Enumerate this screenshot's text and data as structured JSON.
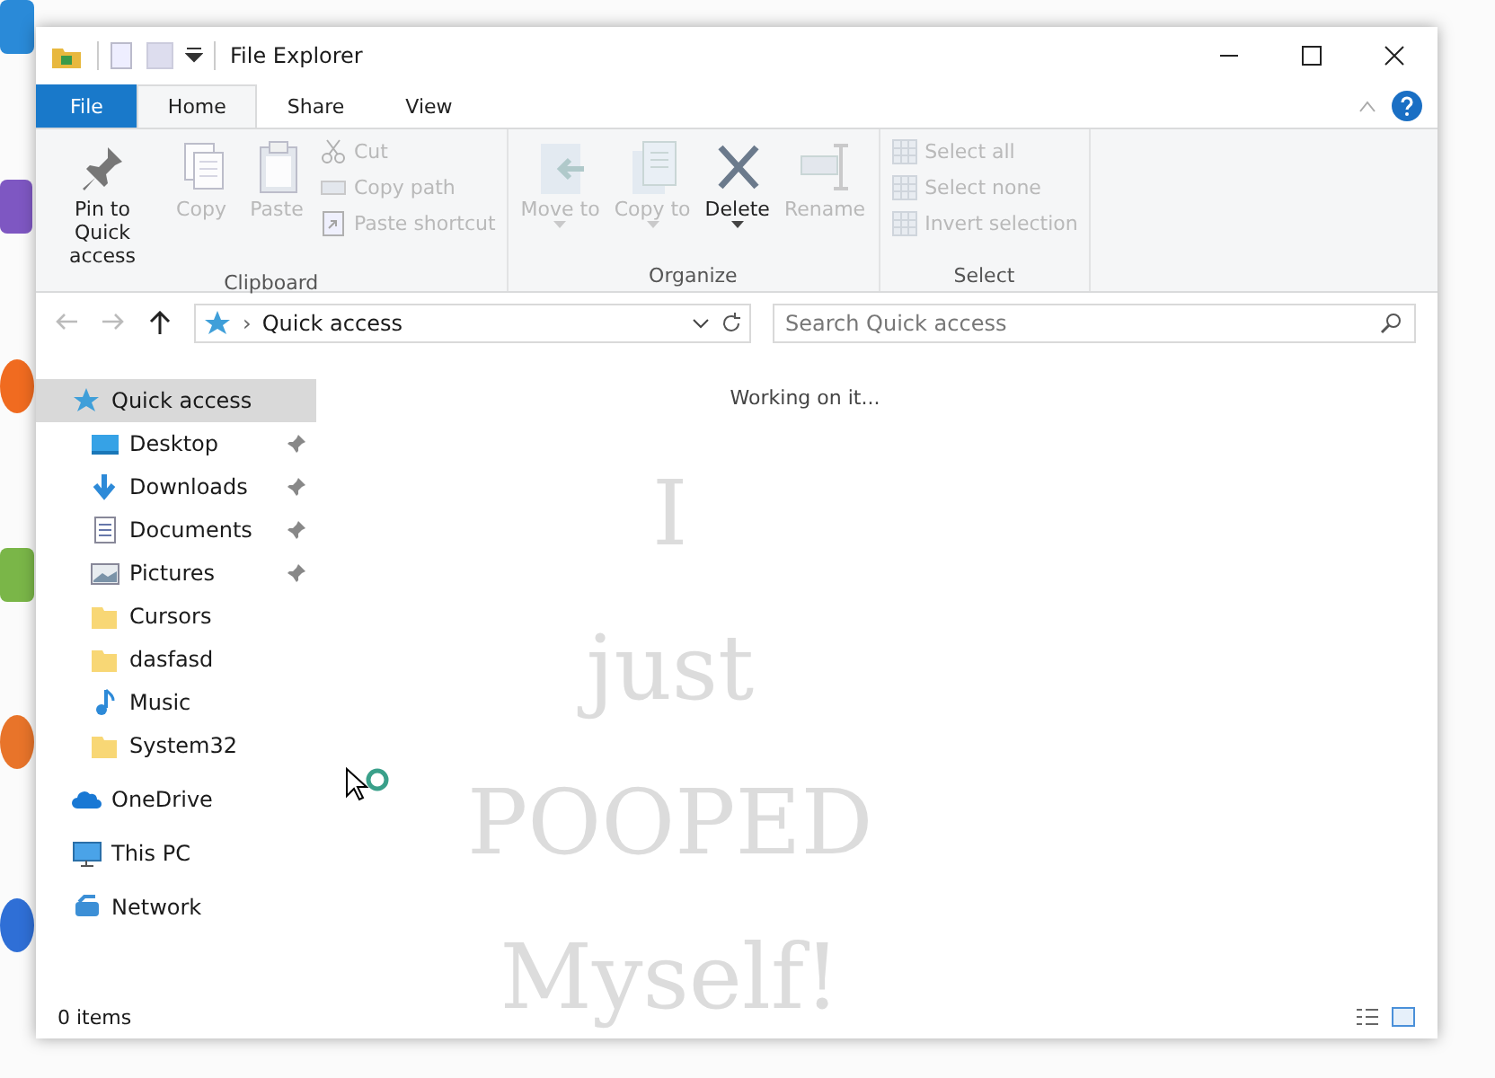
{
  "window": {
    "title": "File Explorer"
  },
  "ribbon_tabs": [
    {
      "label": "File",
      "kind": "file",
      "selected": false
    },
    {
      "label": "Home",
      "kind": "tab",
      "selected": true
    },
    {
      "label": "Share",
      "kind": "tab",
      "selected": false
    },
    {
      "label": "View",
      "kind": "tab",
      "selected": false
    }
  ],
  "ribbon_groups": [
    {
      "label": "Clipboard",
      "large": [
        {
          "label": "Pin to Quick access",
          "kind": "pin",
          "disabled": false
        },
        {
          "label": "Copy",
          "kind": "copy",
          "disabled": true
        },
        {
          "label": "Paste",
          "kind": "paste",
          "disabled": true
        }
      ],
      "small": [
        {
          "label": "Cut",
          "kind": "cut",
          "disabled": true
        },
        {
          "label": "Copy path",
          "kind": "path",
          "disabled": true
        },
        {
          "label": "Paste shortcut",
          "kind": "shortcut",
          "disabled": true
        }
      ]
    },
    {
      "label": "Organize",
      "large": [
        {
          "label": "Move to",
          "kind": "move",
          "disabled": true,
          "dropdown": true
        },
        {
          "label": "Copy to",
          "kind": "copyto",
          "disabled": true,
          "dropdown": true
        },
        {
          "label": "Delete",
          "kind": "delete",
          "disabled": false,
          "dropdown": true
        },
        {
          "label": "Rename",
          "kind": "rename",
          "disabled": true,
          "dropdown": false
        }
      ]
    },
    {
      "label": "Select",
      "small": [
        {
          "label": "Select all",
          "kind": "grid",
          "disabled": true
        },
        {
          "label": "Select none",
          "kind": "grid",
          "disabled": true
        },
        {
          "label": "Invert selection",
          "kind": "grid",
          "disabled": true
        }
      ]
    }
  ],
  "navigation": [
    {
      "kind": "back",
      "disabled": true
    },
    {
      "kind": "forward",
      "disabled": true
    },
    {
      "kind": "up",
      "disabled": false
    }
  ],
  "address": {
    "separator": "›",
    "value": "Quick access"
  },
  "search": {
    "placeholder": "Search Quick access"
  },
  "sidebar": {
    "items": [
      {
        "label": "Quick access",
        "kind": "star",
        "selected": true,
        "children": [
          {
            "label": "Desktop",
            "kind": "desktop",
            "pinned": true,
            "selected": false
          },
          {
            "label": "Downloads",
            "kind": "download",
            "pinned": true,
            "selected": false
          },
          {
            "label": "Documents",
            "kind": "document",
            "pinned": true,
            "selected": false
          },
          {
            "label": "Pictures",
            "kind": "pictures",
            "pinned": true,
            "selected": false
          },
          {
            "label": "Cursors",
            "kind": "folder",
            "pinned": false,
            "selected": false
          },
          {
            "label": "dasfasd",
            "kind": "folder",
            "pinned": false,
            "selected": false
          },
          {
            "label": "Music",
            "kind": "music",
            "pinned": false,
            "selected": false
          },
          {
            "label": "System32",
            "kind": "folder",
            "pinned": false,
            "selected": false
          }
        ]
      },
      {
        "label": "OneDrive",
        "kind": "cloud",
        "selected": false
      },
      {
        "label": "This PC",
        "kind": "pc",
        "selected": false
      },
      {
        "label": "Network",
        "kind": "network",
        "selected": false
      }
    ]
  },
  "content": {
    "message": "Working on it..."
  },
  "scribble": [
    "I",
    "just",
    "POOPED",
    "Myself!"
  ],
  "status_bar": {
    "count": "0 items"
  }
}
